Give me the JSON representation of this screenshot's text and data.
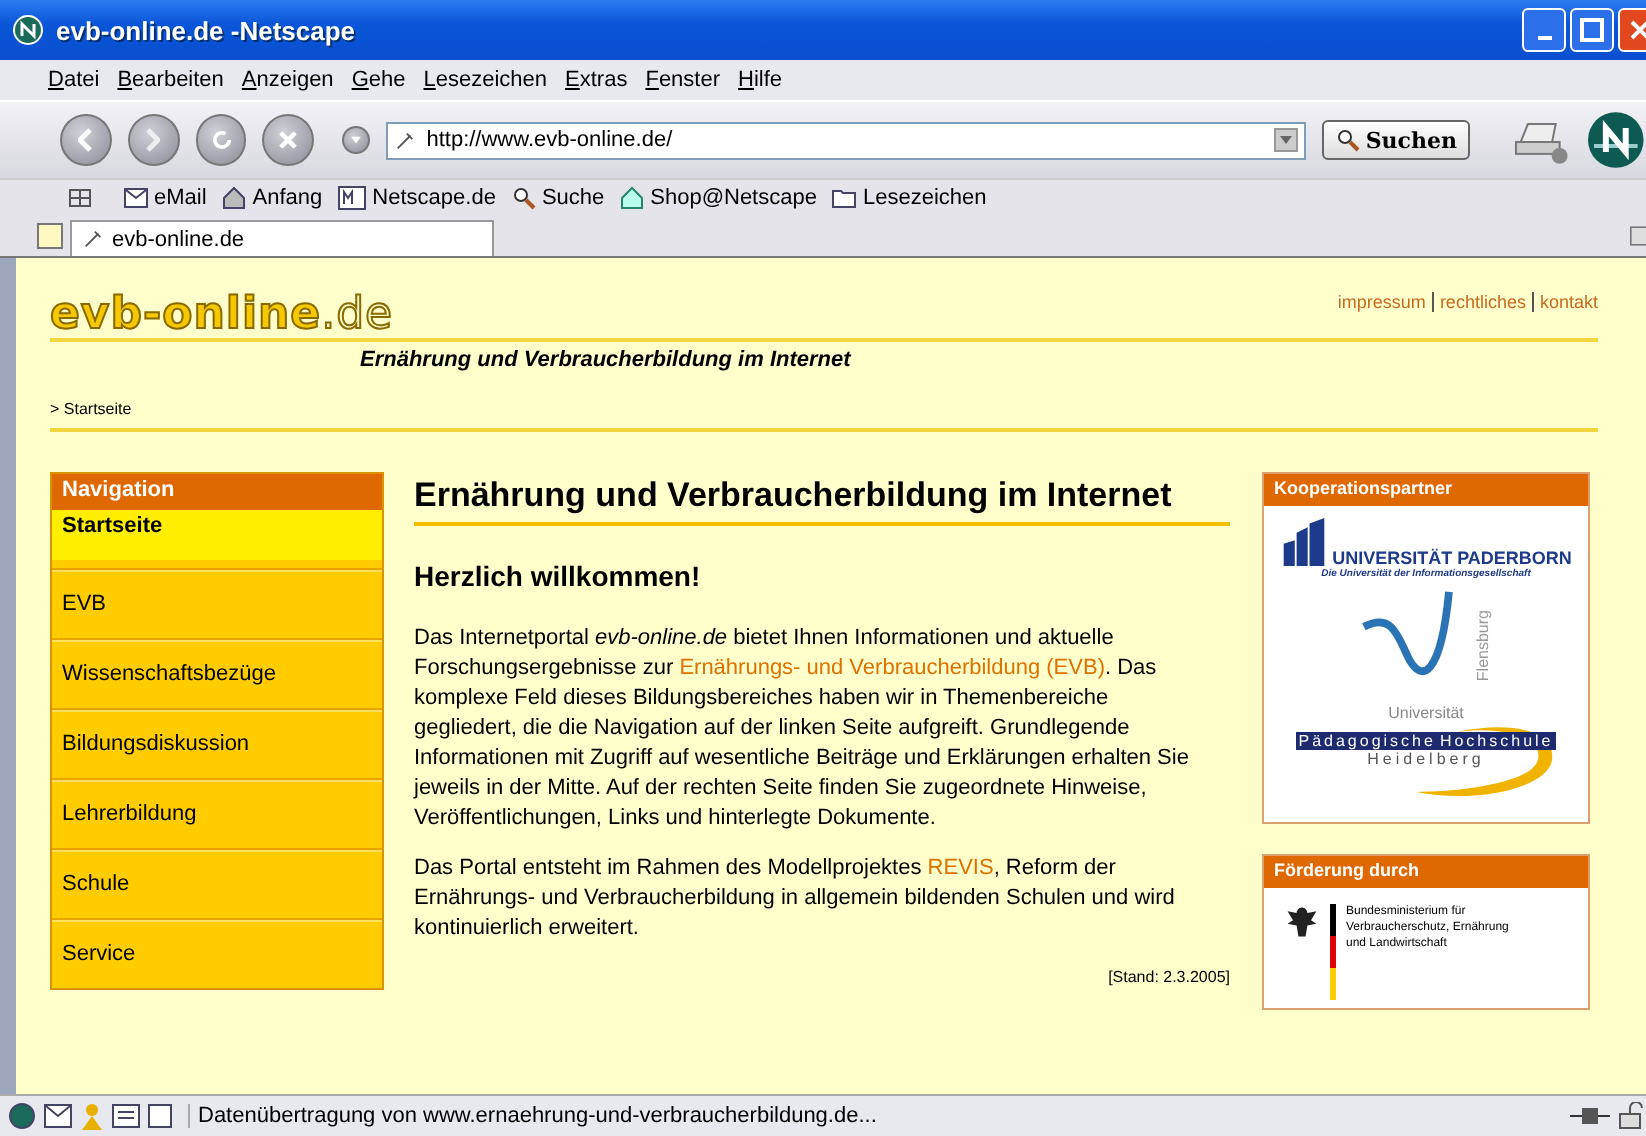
{
  "window": {
    "title": "evb-online.de -Netscape"
  },
  "menu": [
    "Datei",
    "Bearbeiten",
    "Anzeigen",
    "Gehe",
    "Lesezeichen",
    "Extras",
    "Fenster",
    "Hilfe"
  ],
  "nav_toolbar": {
    "url": "http://www.evb-online.de/",
    "search_button": "Suchen"
  },
  "personal_toolbar": [
    {
      "label": "eMail",
      "kind": "mail"
    },
    {
      "label": "Anfang",
      "kind": "home"
    },
    {
      "label": "Netscape.de",
      "kind": "my"
    },
    {
      "label": "Suche",
      "kind": "search"
    },
    {
      "label": "Shop@Netscape",
      "kind": "shop"
    },
    {
      "label": "Lesezeichen",
      "kind": "bookmarks"
    }
  ],
  "tabs": [
    {
      "label": "evb-online.de",
      "selected": true
    }
  ],
  "page": {
    "logo": {
      "main": "evb-online",
      "suffix": ".de"
    },
    "top_links": [
      "impressum",
      "rechtliches",
      "kontakt"
    ],
    "tagline": "Ernährung und Verbraucherbildung im Internet",
    "breadcrumb": "> Startseite",
    "navigation": {
      "title": "Navigation",
      "items": [
        {
          "label": "Startseite",
          "selected": true
        },
        {
          "label": "EVB",
          "selected": false
        },
        {
          "label": "Wissenschaftsbezüge",
          "selected": false
        },
        {
          "label": "Bildungsdiskussion",
          "selected": false
        },
        {
          "label": "Lehrerbildung",
          "selected": false
        },
        {
          "label": "Schule",
          "selected": false
        },
        {
          "label": "Service",
          "selected": false
        }
      ]
    },
    "heading": "Ernährung und Verbraucherbildung im Internet",
    "subheading": "Herzlich willkommen!",
    "paragraphs": [
      [
        {
          "kind": "text",
          "text": "Das Internetportal *evb-online.de* bietet Ihnen Informationen und aktuelle Forschungsergebnisse zur "
        },
        {
          "kind": "link",
          "text": "Ernährungs- und Verbraucherbildung (EVB)"
        },
        {
          "kind": "text",
          "text": ". Das komplexe Feld dieses Bildungsbereiches haben wir in Themenbereiche gegliedert, die die Navigation auf der linken Seite aufgreift. Grundlegende Informationen mit Zugriff auf wesentliche Beiträge und Erklärungen erhalten Sie jeweils in der Mitte. Auf der rechten Seite finden Sie zugeordnete Hinweise, Veröffentlichungen, Links und hinterlegte Dokumente."
        }
      ],
      [
        {
          "kind": "text",
          "text": "Das Portal entsteht im Rahmen des Modellprojektes "
        },
        {
          "kind": "link",
          "text": "REVIS"
        },
        {
          "kind": "text",
          "text": ", Reform der Ernährungs- und Verbraucherbildung in allgemein bildenden Schulen und wird kontinuierlich erweitert."
        }
      ]
    ],
    "stand": "[Stand: 2.3.2005]",
    "partners": {
      "title": "Kooperationspartner",
      "paderborn": {
        "name": "UNIVERSITÄT PADERBORN",
        "motto": "Die Universität der Informationsgesellschaft"
      },
      "flensburg": {
        "name": "Universität",
        "city": "Flensburg"
      },
      "heidelberg": {
        "name_1": "Pädagogische",
        "name_2": "Hochschule",
        "city": "Heidelberg"
      }
    },
    "funding": {
      "title": "Förderung durch",
      "ministry": [
        "Bundesministerium für",
        "Verbraucherschutz, Ernährung",
        "und Landwirtschaft"
      ]
    }
  },
  "status_bar": {
    "text": "Datenübertragung von www.ernaehrung-und-verbraucherbildung.de..."
  }
}
